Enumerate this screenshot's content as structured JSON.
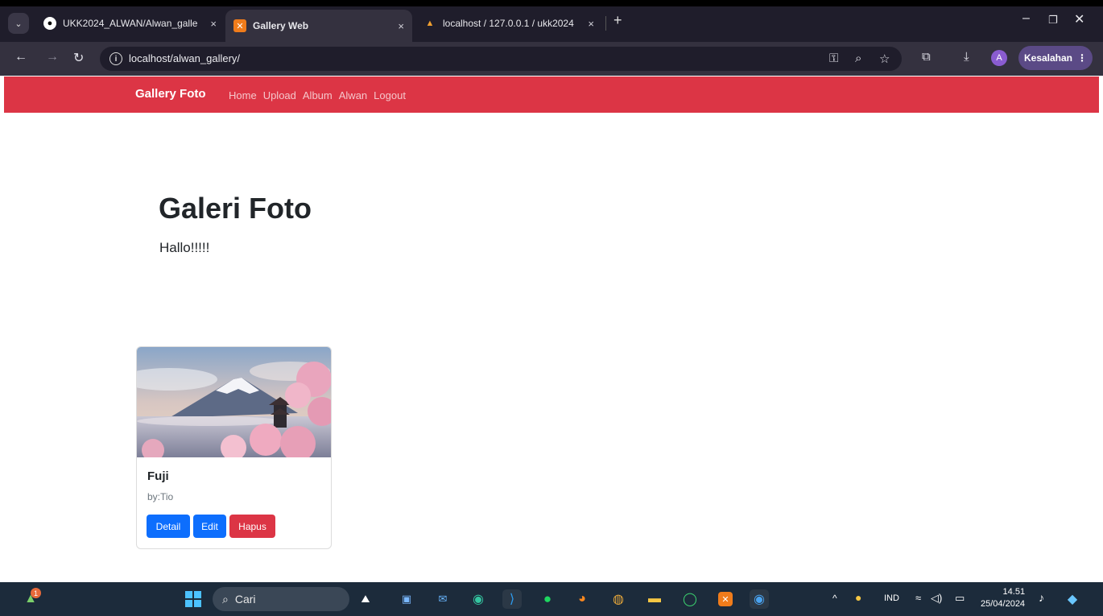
{
  "browser": {
    "tabs": [
      {
        "title": "UKK2024_ALWAN/Alwan_galle",
        "icon": "github-icon",
        "active": false
      },
      {
        "title": "Gallery Web",
        "icon": "xampp-icon",
        "active": true
      },
      {
        "title": "localhost / 127.0.0.1 / ukk2024",
        "icon": "phpmyadmin-icon",
        "active": false
      }
    ],
    "close_glyph": "×",
    "new_tab_glyph": "+",
    "url": "localhost/alwan_gallery/",
    "profile_initial": "A",
    "error_label": "Kesalahan"
  },
  "navbar": {
    "brand": "Gallery Foto",
    "links": [
      "Home",
      "Upload",
      "Album",
      "Alwan",
      "Logout"
    ]
  },
  "hero": {
    "title": "Galeri Foto",
    "text": "Hallo!!!!!"
  },
  "photo_card": {
    "title": "Fuji",
    "author": "by:Tio",
    "buttons": {
      "detail": "Detail",
      "edit": "Edit",
      "delete": "Hapus"
    }
  },
  "taskbar": {
    "search_placeholder": "Cari",
    "language": "IND",
    "time": "14.51",
    "date": "25/04/2024",
    "notification_badge": "1"
  },
  "colors": {
    "navbar": "#dc3545",
    "primary": "#0d6efd",
    "danger": "#dc3545",
    "browser_frame": "#1f1d2b",
    "taskbar": "#1c2b3b"
  }
}
